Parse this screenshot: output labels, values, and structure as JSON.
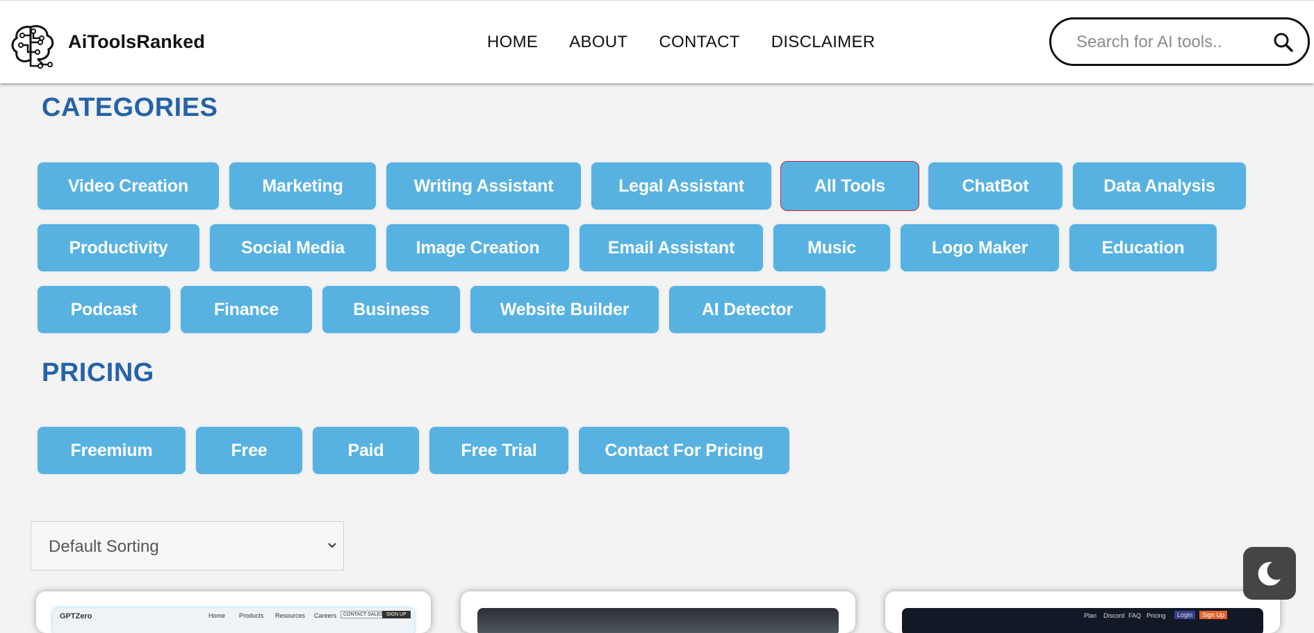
{
  "header": {
    "brand": "AiToolsRanked",
    "nav": [
      "HOME",
      "ABOUT",
      "CONTACT",
      "DISCLAIMER"
    ],
    "search_placeholder": "Search for AI tools.."
  },
  "categories": {
    "title": "CATEGORIES",
    "rows": [
      [
        "Video Creation",
        "Marketing",
        "Writing Assistant",
        "Legal Assistant",
        "All Tools",
        "ChatBot",
        "Data Analysis"
      ],
      [
        "Productivity",
        "Social Media",
        "Image Creation",
        "Email Assistant",
        "Music",
        "Logo Maker",
        "Education"
      ],
      [
        "Podcast",
        "Finance",
        "Business",
        "Website Builder",
        "AI Detector"
      ]
    ],
    "active": "All Tools"
  },
  "pricing": {
    "title": "PRICING",
    "items": [
      "Freemium",
      "Free",
      "Paid",
      "Free Trial",
      "Contact For Pricing"
    ]
  },
  "sort": {
    "selected": "Default Sorting"
  },
  "cards": [
    {
      "site_name": "GPTZero",
      "nav": [
        "Home",
        "Products",
        "Resources",
        "Careers",
        "CONTACT SALES",
        "SIGN UP"
      ]
    },
    {
      "site_name": ""
    },
    {
      "site_name": "",
      "nav": [
        "Plan",
        "Discord",
        "FAQ",
        "Pricing",
        "Login",
        "Sign Up"
      ]
    }
  ],
  "colors": {
    "accent": "#57b2e2",
    "title": "#2563a8",
    "active_border": "#c0273a"
  },
  "icons": {
    "search": "search-icon",
    "moon": "moon-icon",
    "chevron": "chevron-down-icon",
    "logo": "brain-circuit-icon"
  }
}
